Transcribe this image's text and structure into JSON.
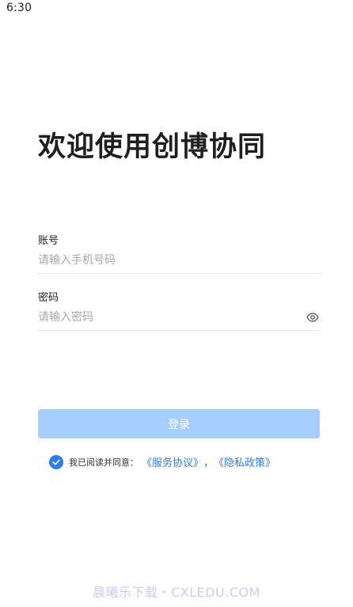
{
  "status_bar": {
    "time": "6:30"
  },
  "welcome_title": "欢迎使用创博协同",
  "account": {
    "label": "账号",
    "placeholder": "请输入手机号码",
    "value": ""
  },
  "password": {
    "label": "密码",
    "placeholder": "请输入密码",
    "value": "",
    "toggle_icon": "eye-icon"
  },
  "login_button": {
    "label": "登录"
  },
  "agreement": {
    "checked": true,
    "text": "我已阅读并同意：",
    "service_link": "《服务协议》",
    "separator": "，",
    "privacy_link": "《隐私政策》"
  },
  "watermark": "晨曦乐下载・CXLEDU.COM",
  "colors": {
    "primary": "#2f7cf6",
    "button_disabled": "#a5ceff",
    "placeholder": "#a9a9a9",
    "divider": "#e9e9e9"
  }
}
